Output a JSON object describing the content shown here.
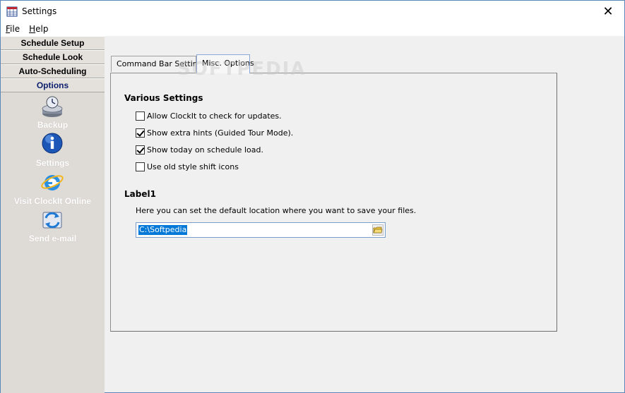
{
  "window": {
    "title": "Settings",
    "close_glyph": "✕"
  },
  "menu": [
    {
      "label": "File",
      "accel": "F",
      "rest": "ile"
    },
    {
      "label": "Help",
      "accel": "H",
      "rest": "elp"
    }
  ],
  "sidebar": {
    "tabs": [
      "Schedule Setup",
      "Schedule Look",
      "Auto-Scheduling",
      "Options"
    ],
    "active_tab": "Options",
    "links": [
      {
        "label": "Backup",
        "icon": "backup-disk-icon"
      },
      {
        "label": "Settings",
        "icon": "info-icon"
      },
      {
        "label": "Visit ClockIt Online",
        "icon": "internet-explorer-icon"
      },
      {
        "label": "Send e-mail",
        "icon": "send-email-icon"
      }
    ]
  },
  "tabs": [
    {
      "label": "Command Bar Settings"
    },
    {
      "label": "Misc. Options"
    }
  ],
  "active_tab": "Misc. Options",
  "watermark": "SOFTPEDIA",
  "various": {
    "title": "Various Settings",
    "options": [
      {
        "label": "Allow ClockIt to check for updates.",
        "checked": false
      },
      {
        "label": "Show extra hints (Guided Tour Mode).",
        "checked": true
      },
      {
        "label": "Show today on schedule load.",
        "checked": true
      },
      {
        "label": "Use old style shift icons",
        "checked": false
      }
    ]
  },
  "label1": {
    "title": "Label1",
    "description": "Here you can set the default location where you want to save your files.",
    "path_value": "C:\\Softpedia"
  },
  "colors": {
    "accent": "#0078d7",
    "sidebar_bg": "#e4e1dc",
    "active_tab_text": "#0c1f6d"
  }
}
